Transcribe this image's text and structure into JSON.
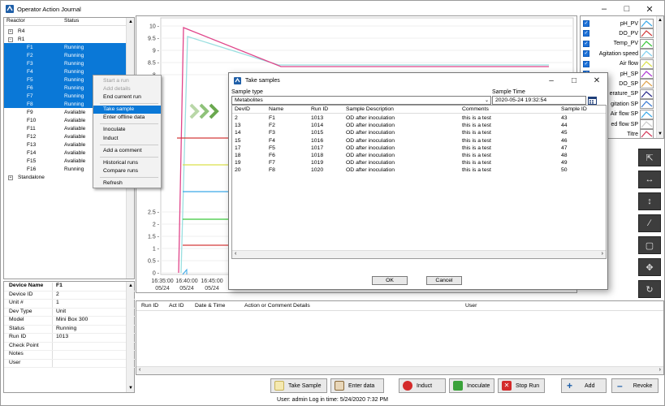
{
  "app": {
    "title": "Operator Action Journal"
  },
  "reactor_tree": {
    "headers": [
      "Reactor",
      "Status"
    ],
    "groups": [
      {
        "label": "R4",
        "expander": "+"
      },
      {
        "label": "R1",
        "expander": "−"
      }
    ],
    "rows": [
      {
        "name": "F1",
        "status": "Running"
      },
      {
        "name": "F2",
        "status": "Running"
      },
      {
        "name": "F3",
        "status": "Running"
      },
      {
        "name": "F4",
        "status": "Running"
      },
      {
        "name": "F5",
        "status": "Running"
      },
      {
        "name": "F6",
        "status": "Running"
      },
      {
        "name": "F7",
        "status": "Running"
      },
      {
        "name": "F8",
        "status": "Running"
      },
      {
        "name": "F9",
        "status": "Avaliable"
      },
      {
        "name": "F10",
        "status": "Avaliable"
      },
      {
        "name": "F11",
        "status": "Avaliable"
      },
      {
        "name": "F12",
        "status": "Avaliable"
      },
      {
        "name": "F13",
        "status": "Avaliable"
      },
      {
        "name": "F14",
        "status": "Avaliable"
      },
      {
        "name": "F15",
        "status": "Avaliable"
      },
      {
        "name": "F16",
        "status": "Running"
      }
    ],
    "standalone": {
      "label": "Standalone",
      "expander": "+"
    }
  },
  "context_menu": {
    "items": [
      "Start a run",
      "Add details",
      "End current run",
      "Take sample",
      "Enter offline data",
      "Inoculate",
      "Induct",
      "Add a comment",
      "Historical runs",
      "Compare runs",
      "Refresh"
    ]
  },
  "properties": {
    "rows": [
      {
        "key": "Device Name",
        "value": "F1"
      },
      {
        "key": "Device ID",
        "value": "2"
      },
      {
        "key": "Unit #",
        "value": "1"
      },
      {
        "key": "Dev Type",
        "value": "Unit"
      },
      {
        "key": "Model",
        "value": "Mini Box 300"
      },
      {
        "key": "Status",
        "value": "Running"
      },
      {
        "key": "Run ID",
        "value": "1013"
      },
      {
        "key": "Check Point",
        "value": ""
      },
      {
        "key": "Notes",
        "value": ""
      },
      {
        "key": "User",
        "value": ""
      }
    ]
  },
  "chart_data": {
    "type": "line",
    "y_ticks": [
      "10 -",
      "9.5 -",
      "9 -",
      "8.5 -",
      "8 -",
      "2.5 -",
      "2 -",
      "1.5 -",
      "1 -",
      "0.5 -",
      "0 -"
    ],
    "x_ticks": [
      {
        "time": "16:35:00",
        "date": "05/24"
      },
      {
        "time": "16:40:00",
        "date": "05/24"
      },
      {
        "time": "16:45:00",
        "date": "05/24"
      }
    ],
    "ylim": [
      0,
      10
    ],
    "series": [
      {
        "name": "pH_PV",
        "color": "#9adfe0"
      },
      {
        "name": "Titre",
        "color": "#e0458a"
      },
      {
        "name": "Temp_PV",
        "color": "#3ac63a"
      },
      {
        "name": "Agitation speed",
        "color": "#3aa9e8"
      },
      {
        "name": "Air flow",
        "color": "#d9e04a"
      },
      {
        "name": "DO_PV",
        "color": "#d43a3a"
      }
    ]
  },
  "legend": {
    "items": [
      {
        "label": "pH_PV",
        "color": "#3aa9e8"
      },
      {
        "label": "DO_PV",
        "color": "#d43a3a"
      },
      {
        "label": "Temp_PV",
        "color": "#3ac63a"
      },
      {
        "label": "Agitation speed",
        "color": "#7fd0f0"
      },
      {
        "label": "Air flow",
        "color": "#d9e04a"
      },
      {
        "label": "pH_SP",
        "color": "#b03ad4"
      },
      {
        "label": "DO_SP",
        "color": "#e0a24a"
      },
      {
        "label": "erature_SP",
        "color": "#2a2a8a"
      },
      {
        "label": "gitation SP",
        "color": "#3a7ad4"
      },
      {
        "label": "Air flow SP",
        "color": "#3aa9e8"
      },
      {
        "label": "ed flow SP",
        "color": "#cccccc"
      },
      {
        "label": "Titre",
        "color": "#d43a5a"
      }
    ]
  },
  "log": {
    "headers": [
      "Run ID",
      "Act ID",
      "Date & Time",
      "Action or Comment Details",
      "User"
    ]
  },
  "buttons": {
    "take_sample": "Take Sample",
    "enter_data": "Enter data",
    "induct": "Induct",
    "inoculate": "Inoculate",
    "stop_run": "Stop Run",
    "add": "Add",
    "revoke": "Revoke"
  },
  "status_bar": {
    "text": "User: admin   Log in time: 5/24/2020 7:32 PM"
  },
  "dialog": {
    "title": "Take samples",
    "sample_type_label": "Sample type",
    "sample_type_value": "Metabolites",
    "sample_time_label": "Sample Time",
    "sample_time_value": "2020-05-24 19:32:54",
    "headers": [
      "DevID",
      "Name",
      "Run ID",
      "Sample Description",
      "Comments",
      "Sample ID"
    ],
    "rows": [
      [
        "2",
        "F1",
        "1013",
        "OD after inoculation",
        "this is a test",
        "43"
      ],
      [
        "13",
        "F2",
        "1014",
        "OD after inoculation",
        "this is a test",
        "44"
      ],
      [
        "14",
        "F3",
        "1015",
        "OD after inoculation",
        "this is a test",
        "45"
      ],
      [
        "15",
        "F4",
        "1016",
        "OD after inoculation",
        "this is a test",
        "46"
      ],
      [
        "17",
        "F5",
        "1017",
        "OD after inoculation",
        "this is a test",
        "47"
      ],
      [
        "18",
        "F6",
        "1018",
        "OD after inoculation",
        "this is a test",
        "48"
      ],
      [
        "19",
        "F7",
        "1019",
        "OD after inoculation",
        "this is a test",
        "49"
      ],
      [
        "20",
        "F8",
        "1020",
        "OD after inoculation",
        "this is a test",
        "50"
      ]
    ],
    "ok": "OK",
    "cancel": "Cancel"
  }
}
